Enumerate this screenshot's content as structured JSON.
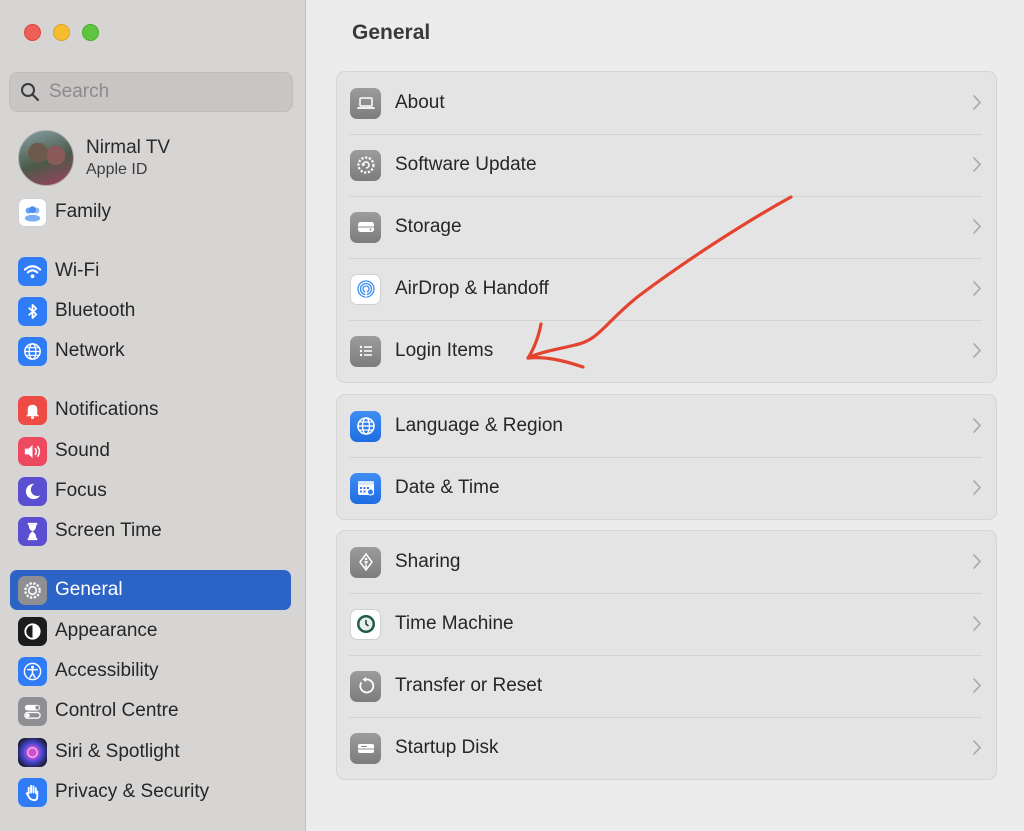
{
  "window": {
    "controls": [
      "close",
      "minimize",
      "zoom"
    ]
  },
  "search": {
    "placeholder": "Search",
    "value": ""
  },
  "profile": {
    "name": "Nirmal TV",
    "subtitle": "Apple ID"
  },
  "sidebar": {
    "items": [
      {
        "label": "Family",
        "icon": "family-icon",
        "color": "#ffffff"
      },
      {
        "label": "Wi-Fi",
        "icon": "wifi-icon",
        "color": "#2f7cf6"
      },
      {
        "label": "Bluetooth",
        "icon": "bluetooth-icon",
        "color": "#2f7cf6"
      },
      {
        "label": "Network",
        "icon": "globe-icon",
        "color": "#2f7cf6"
      },
      {
        "label": "Notifications",
        "icon": "bell-icon",
        "color": "#ee4b45"
      },
      {
        "label": "Sound",
        "icon": "speaker-icon",
        "color": "#ee4a5f"
      },
      {
        "label": "Focus",
        "icon": "moon-icon",
        "color": "#5b4fd1"
      },
      {
        "label": "Screen Time",
        "icon": "hourglass-icon",
        "color": "#5b4fd1"
      },
      {
        "label": "General",
        "icon": "gear-icon",
        "color": "#8e8e93",
        "active": true
      },
      {
        "label": "Appearance",
        "icon": "appearance-icon",
        "color": "#1c1c1e"
      },
      {
        "label": "Accessibility",
        "icon": "accessibility-icon",
        "color": "#2f7cf6"
      },
      {
        "label": "Control Centre",
        "icon": "toggles-icon",
        "color": "#8e8e93"
      },
      {
        "label": "Siri & Spotlight",
        "icon": "siri-icon",
        "color": "#2b2b8f"
      },
      {
        "label": "Privacy & Security",
        "icon": "hand-icon",
        "color": "#2f7cf6"
      }
    ]
  },
  "main": {
    "title": "General",
    "groups": [
      {
        "rows": [
          {
            "label": "About",
            "icon": "laptop-icon"
          },
          {
            "label": "Software Update",
            "icon": "gear-update-icon"
          },
          {
            "label": "Storage",
            "icon": "drive-icon"
          },
          {
            "label": "AirDrop & Handoff",
            "icon": "airdrop-icon"
          },
          {
            "label": "Login Items",
            "icon": "list-icon"
          }
        ]
      },
      {
        "rows": [
          {
            "label": "Language & Region",
            "icon": "globe-icon"
          },
          {
            "label": "Date & Time",
            "icon": "calendar-icon"
          }
        ]
      },
      {
        "rows": [
          {
            "label": "Sharing",
            "icon": "sharing-icon"
          },
          {
            "label": "Time Machine",
            "icon": "time-machine-icon"
          },
          {
            "label": "Transfer or Reset",
            "icon": "reset-icon"
          },
          {
            "label": "Startup Disk",
            "icon": "disk-icon"
          }
        ]
      }
    ]
  },
  "colors": {
    "accent": "#2c63c7",
    "annotation_arrow": "#e4432f"
  }
}
